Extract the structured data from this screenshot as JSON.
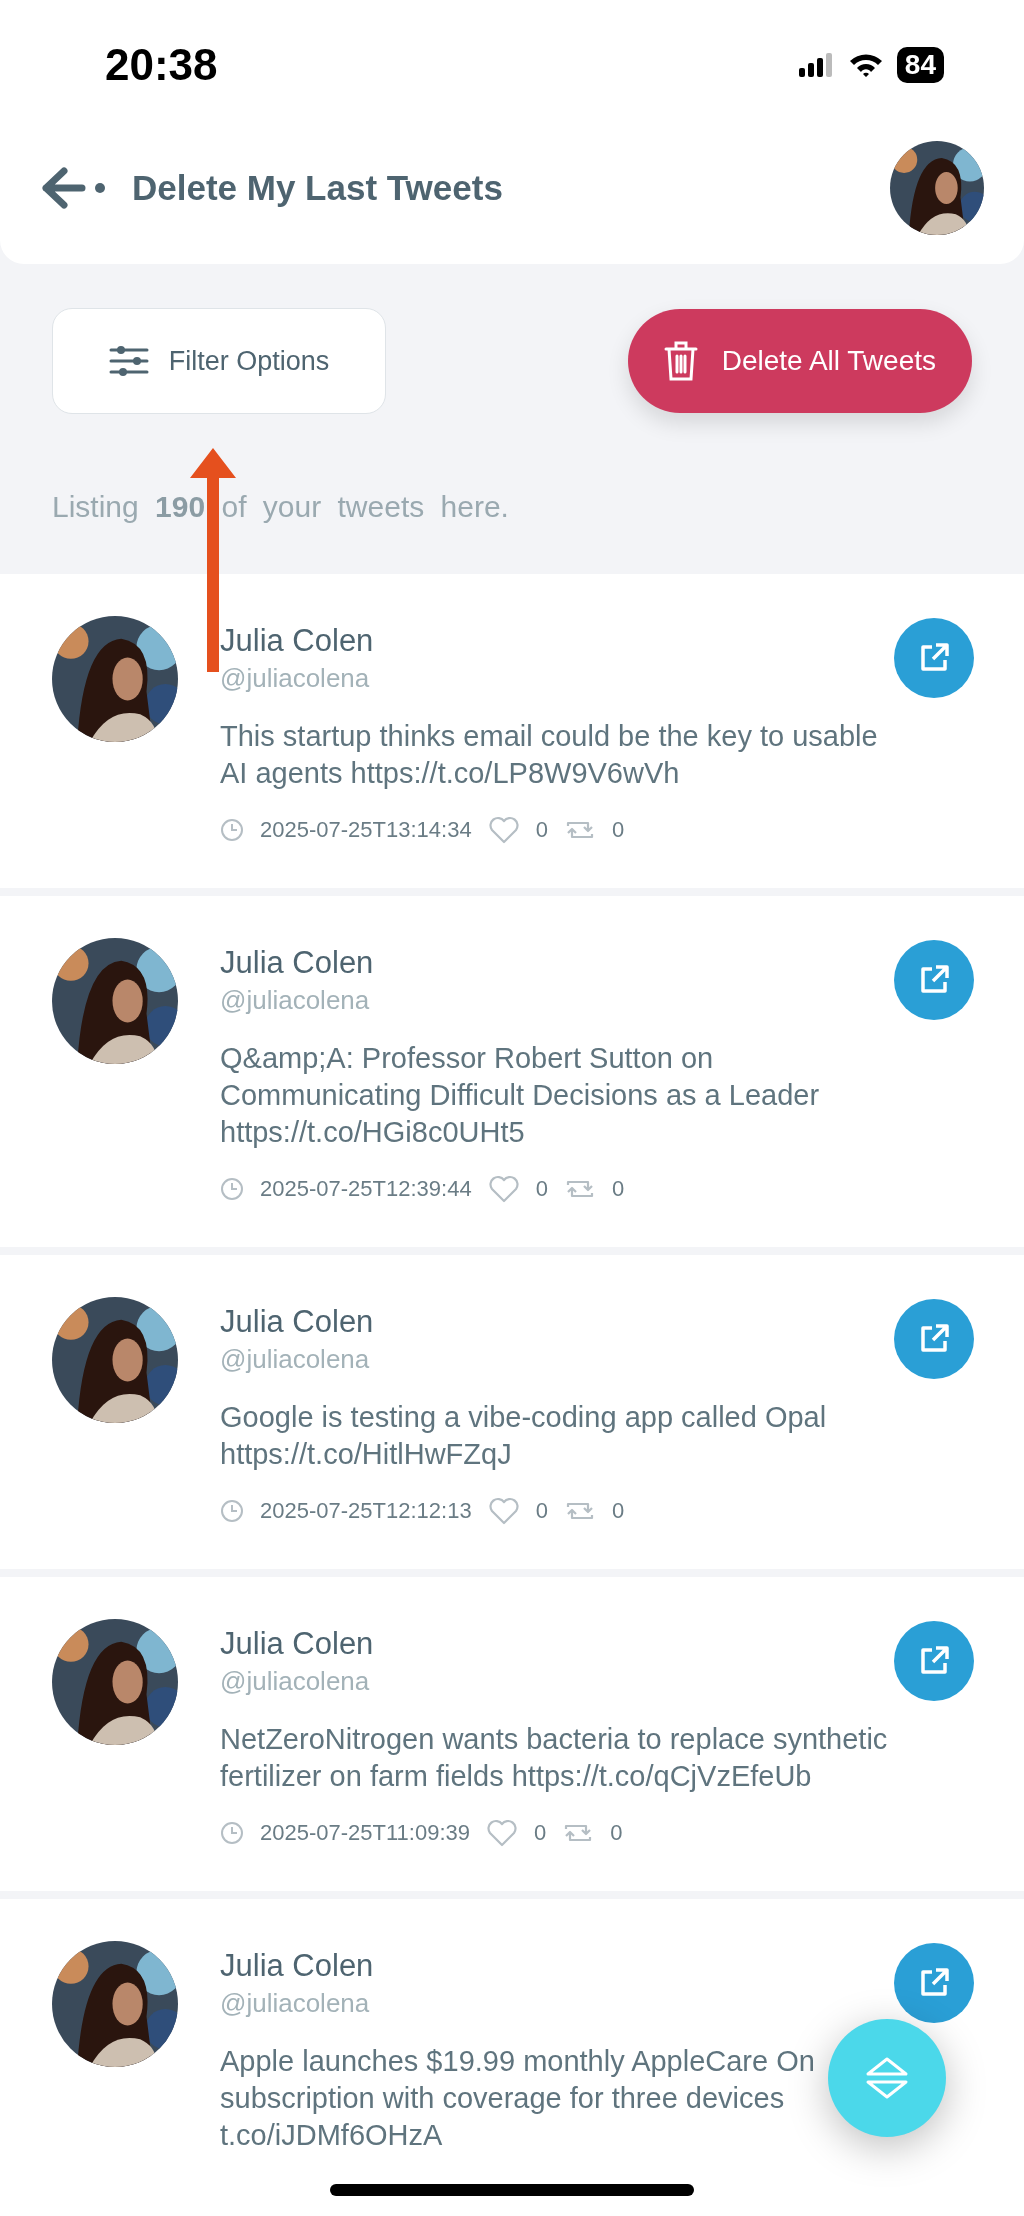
{
  "status_bar": {
    "time": "20:38",
    "battery": "84"
  },
  "header": {
    "title": "Delete My Last Tweets"
  },
  "actions": {
    "filter": "Filter Options",
    "delete_all": "Delete All Tweets"
  },
  "summary": {
    "text": "Listing **190** of your tweets here."
  },
  "tweets": [
    {
      "name": "Julia Colen",
      "handle": "@juliacolena",
      "text": "This startup thinks email could be the key to usable AI agents https://t.co/LP8W9V6wVh",
      "time": "2025-07-25T13:14:34",
      "likes": "0",
      "retweets": "0"
    },
    {
      "name": "Julia Colen",
      "handle": "@juliacolena",
      "text": "Q&amp;A: Professor Robert Sutton on Communicating Difficult Decisions as a Leader https://t.co/HGi8c0UHt5",
      "time": "2025-07-25T12:39:44",
      "likes": "0",
      "retweets": "0"
    },
    {
      "name": "Julia Colen",
      "handle": "@juliacolena",
      "text": "Google is testing a vibe-coding app called Opal https://t.co/HitlHwFZqJ",
      "time": "2025-07-25T12:12:13",
      "likes": "0",
      "retweets": "0"
    },
    {
      "name": "Julia Colen",
      "handle": "@juliacolena",
      "text": "NetZeroNitrogen wants bacteria to replace synthetic fertilizer on farm fields https://t.co/qCjVzEfeUb",
      "time": "2025-07-25T11:09:39",
      "likes": "0",
      "retweets": "0"
    },
    {
      "name": "Julia Colen",
      "handle": "@juliacolena",
      "lines": [
        "Apple launches $19.99 monthly AppleCare On",
        "subscription with coverage for three devices",
        "t.co/iJDMf6OHzA"
      ]
    }
  ]
}
